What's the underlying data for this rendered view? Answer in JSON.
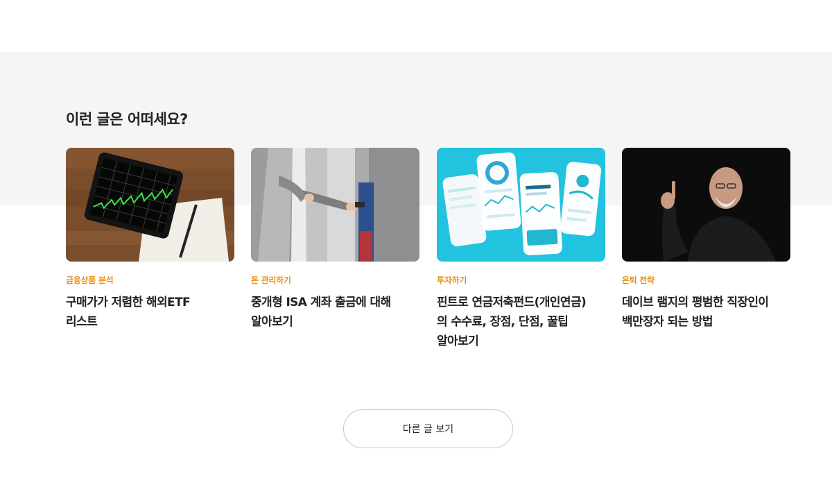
{
  "section": {
    "title": "이런 글은 어떠세요?"
  },
  "cards": [
    {
      "category": "금융상품 분석",
      "title_line1": "구매가가 저렴한 해외ETF",
      "title_line2": "리스트",
      "title_line3": ""
    },
    {
      "category": "돈 관리하기",
      "title_line1": "중개형 ISA 계좌 출금에 대해",
      "title_line2": "알아보기",
      "title_line3": ""
    },
    {
      "category": "투자하기",
      "title_line1": "핀트로 연금저축펀드(개인연금)",
      "title_line2": "의 수수료, 장점, 단점, 꿀팁",
      "title_line3": "알아보기"
    },
    {
      "category": "은퇴 전략",
      "title_line1": "데이브 램지의 평범한 직장인이",
      "title_line2": "백만장자 되는 방법",
      "title_line3": ""
    }
  ],
  "more_button": {
    "label": "다른 글 보기"
  },
  "colors": {
    "accent": "#e8901c",
    "band": "#f5f5f5",
    "text": "#222222"
  }
}
